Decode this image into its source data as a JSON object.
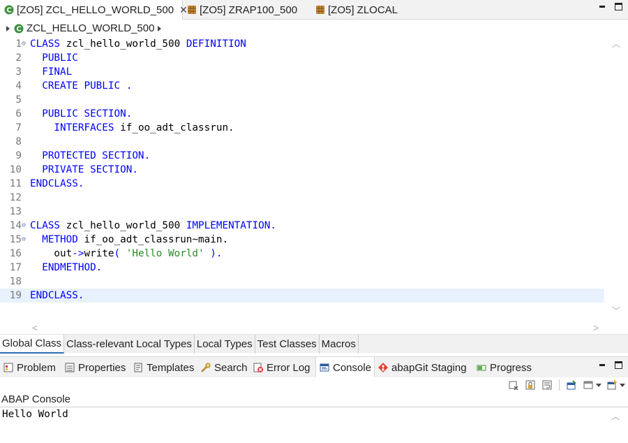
{
  "editor_tabs": [
    {
      "label": "[ZO5] ZCL_HELLO_WORLD_500",
      "icon": "class-icon",
      "active": true,
      "closable": true
    },
    {
      "label": "[ZO5] ZRAP100_500",
      "icon": "table-icon",
      "active": false
    },
    {
      "label": "[ZO5] ZLOCAL",
      "icon": "table-icon",
      "active": false
    }
  ],
  "breadcrumb": {
    "label": "ZCL_HELLO_WORLD_500"
  },
  "code": {
    "current_line": 19,
    "lines": [
      {
        "n": "1",
        "fold": true,
        "tokens": [
          {
            "t": "CLASS ",
            "c": "kw"
          },
          {
            "t": "zcl_hello_world_500 ",
            "c": "id"
          },
          {
            "t": "DEFINITION",
            "c": "kw"
          }
        ]
      },
      {
        "n": "2",
        "tokens": [
          {
            "t": "  PUBLIC",
            "c": "kw"
          }
        ]
      },
      {
        "n": "3",
        "tokens": [
          {
            "t": "  FINAL",
            "c": "kw"
          }
        ]
      },
      {
        "n": "4",
        "tokens": [
          {
            "t": "  CREATE PUBLIC .",
            "c": "kw"
          }
        ]
      },
      {
        "n": "5",
        "tokens": []
      },
      {
        "n": "6",
        "tokens": [
          {
            "t": "  PUBLIC SECTION.",
            "c": "kw"
          }
        ]
      },
      {
        "n": "7",
        "tokens": [
          {
            "t": "    INTERFACES ",
            "c": "kw"
          },
          {
            "t": "if_oo_adt_classrun.",
            "c": "id"
          }
        ]
      },
      {
        "n": "8",
        "tokens": []
      },
      {
        "n": "9",
        "tokens": [
          {
            "t": "  PROTECTED SECTION.",
            "c": "kw"
          }
        ]
      },
      {
        "n": "10",
        "tokens": [
          {
            "t": "  PRIVATE SECTION.",
            "c": "kw"
          }
        ]
      },
      {
        "n": "11",
        "tokens": [
          {
            "t": "ENDCLASS.",
            "c": "kw"
          }
        ]
      },
      {
        "n": "12",
        "tokens": []
      },
      {
        "n": "13",
        "tokens": []
      },
      {
        "n": "14",
        "fold": true,
        "tokens": [
          {
            "t": "CLASS ",
            "c": "kw"
          },
          {
            "t": "zcl_hello_world_500 ",
            "c": "id"
          },
          {
            "t": "IMPLEMENTATION.",
            "c": "kw"
          }
        ]
      },
      {
        "n": "15",
        "fold": true,
        "tokens": [
          {
            "t": "  METHOD ",
            "c": "kw"
          },
          {
            "t": "if_oo_adt_classrun~main.",
            "c": "id"
          }
        ]
      },
      {
        "n": "16",
        "tokens": [
          {
            "t": "    out",
            "c": "id"
          },
          {
            "t": "->",
            "c": "kw"
          },
          {
            "t": "write",
            "c": "id"
          },
          {
            "t": "( ",
            "c": "kw"
          },
          {
            "t": "'Hello World'",
            "c": "str"
          },
          {
            "t": " ).",
            "c": "kw"
          }
        ]
      },
      {
        "n": "17",
        "tokens": [
          {
            "t": "  ENDMETHOD.",
            "c": "kw"
          }
        ]
      },
      {
        "n": "18",
        "tokens": []
      },
      {
        "n": "19",
        "tokens": [
          {
            "t": "ENDCLASS.",
            "c": "kw"
          }
        ]
      }
    ]
  },
  "editor_subtabs": [
    {
      "label": "Global Class",
      "active": true
    },
    {
      "label": "Class-relevant Local Types"
    },
    {
      "label": "Local Types"
    },
    {
      "label": "Test Classes"
    },
    {
      "label": "Macros"
    }
  ],
  "view_tabs": [
    {
      "label": "Problem",
      "icon": "problems-icon"
    },
    {
      "label": "Properties",
      "icon": "properties-icon"
    },
    {
      "label": "Templates",
      "icon": "templates-icon"
    },
    {
      "label": "Search",
      "icon": "search-icon"
    },
    {
      "label": "Error Log",
      "icon": "error-log-icon"
    },
    {
      "label": "Console",
      "icon": "console-icon",
      "active": true
    },
    {
      "label": "abapGit Staging",
      "icon": "abapgit-icon"
    },
    {
      "label": "Progress",
      "icon": "progress-icon"
    }
  ],
  "console": {
    "title": "ABAP Console",
    "output": "Hello World"
  }
}
